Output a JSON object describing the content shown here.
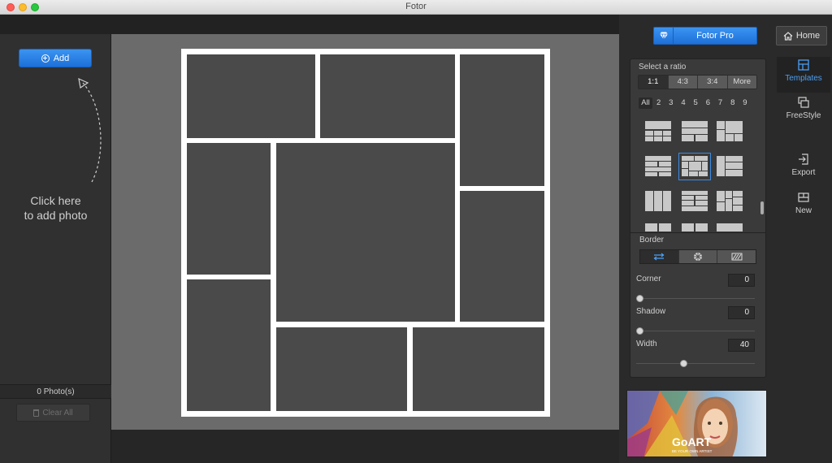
{
  "window": {
    "title": "Fotor"
  },
  "left_panel": {
    "add_label": "Add",
    "hint_line1": "Click here",
    "hint_line2": "to add photo",
    "photo_count": "0 Photo(s)",
    "clear_all_label": "Clear All"
  },
  "top": {
    "pro_label": "Fotor Pro",
    "home_label": "Home"
  },
  "ratio": {
    "title": "Select a ratio",
    "tabs": [
      "1:1",
      "4:3",
      "3:4",
      "More"
    ],
    "active_tab": "1:1",
    "counts": [
      "All",
      "2",
      "3",
      "4",
      "5",
      "6",
      "7",
      "8",
      "9"
    ],
    "active_count": "All"
  },
  "border": {
    "title": "Border",
    "corner_label": "Corner",
    "corner_value": "0",
    "shadow_label": "Shadow",
    "shadow_value": "0",
    "width_label": "Width",
    "width_value": "40",
    "corner_level": 0,
    "shadow_level": 0,
    "width_level": 0.4
  },
  "nav": {
    "templates": "Templates",
    "freestyle": "FreeStyle",
    "export": "Export",
    "new": "New"
  },
  "ad": {
    "brand": "GoART",
    "tagline": "BE YOUR OWN ARTIST"
  },
  "colors": {
    "accent": "#1d70d8",
    "canvas": "#6b6b6b",
    "cell": "#4a4a4a",
    "border": "#ffffff"
  }
}
